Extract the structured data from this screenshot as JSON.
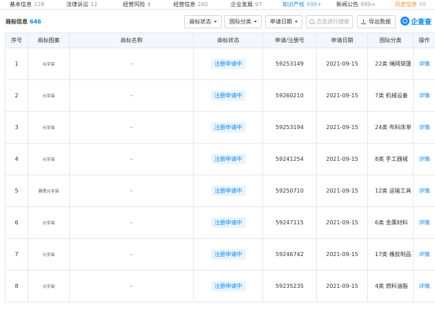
{
  "tabs": [
    {
      "label": "基本信息",
      "count": "228"
    },
    {
      "label": "法律诉讼",
      "count": "12"
    },
    {
      "label": "经营风险",
      "count": "4"
    },
    {
      "label": "经营信息",
      "count": "260"
    },
    {
      "label": "企业发展",
      "count": "97"
    },
    {
      "label": "知识产权",
      "count": "999+"
    },
    {
      "label": "新闻公告",
      "count": "999+"
    },
    {
      "label": "历史信息",
      "count": "88"
    }
  ],
  "section": {
    "title": "商标信息",
    "count": "646"
  },
  "filters": {
    "status": "商标状态",
    "intl_class": "国际分类",
    "apply_date": "申请日期"
  },
  "search": {
    "placeholder": "点击进行搜索"
  },
  "export_label": "导出数据",
  "brand": "企查查",
  "table": {
    "headers": [
      "序号",
      "商标图案",
      "商标名称",
      "商标状态",
      "申请/注册号",
      "申请日期",
      "国际分类",
      "操作"
    ],
    "rows": [
      {
        "no": "1",
        "image_text": "元宇宙",
        "name": "-",
        "status": "注册申请中",
        "reg_no": "59253149",
        "date": "2021-09-15",
        "class": "22类 绳网袋篷",
        "action": "详情"
      },
      {
        "no": "2",
        "image_text": "元宇宙",
        "name": "-",
        "status": "注册申请中",
        "reg_no": "59260210",
        "date": "2021-09-15",
        "class": "7类 机械设备",
        "action": "详情"
      },
      {
        "no": "3",
        "image_text": "元宇宙",
        "name": "-",
        "status": "注册申请中",
        "reg_no": "59253194",
        "date": "2021-09-15",
        "class": "24类 布料床单",
        "action": "详情"
      },
      {
        "no": "4",
        "image_text": "元宇宙",
        "name": "-",
        "status": "注册申请中",
        "reg_no": "59241254",
        "date": "2021-09-15",
        "class": "8类 手工器械",
        "action": "详情"
      },
      {
        "no": "5",
        "image_text": "雅堡元宇宙",
        "name": "-",
        "status": "注册申请中",
        "reg_no": "59250710",
        "date": "2021-09-15",
        "class": "12类 运输工具",
        "action": "详情"
      },
      {
        "no": "6",
        "image_text": "元宇宙",
        "name": "-",
        "status": "注册申请中",
        "reg_no": "59247115",
        "date": "2021-09-15",
        "class": "6类 金属材料",
        "action": "详情"
      },
      {
        "no": "7",
        "image_text": "元宇宙",
        "name": "-",
        "status": "注册申请中",
        "reg_no": "59246742",
        "date": "2021-09-15",
        "class": "17类 橡胶制品",
        "action": "详情"
      },
      {
        "no": "8",
        "image_text": "元宇宙",
        "name": "-",
        "status": "注册申请中",
        "reg_no": "59235235",
        "date": "2021-09-15",
        "class": "4类 燃料油脂",
        "action": "详情"
      }
    ]
  },
  "colors": {
    "accent": "#128bed",
    "history_tab": "#f28d1e",
    "header_bg": "#f2f7fd",
    "badge_bg": "#e8f4fe"
  }
}
